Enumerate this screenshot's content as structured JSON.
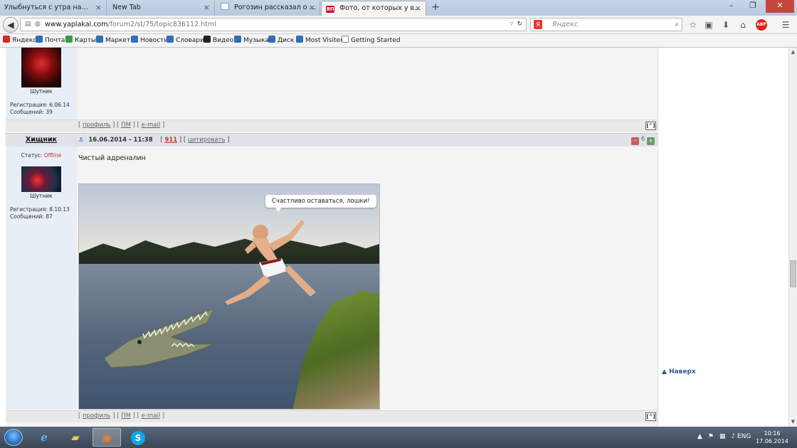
{
  "browser": {
    "tabs": [
      {
        "label": "Улыбнуться с утра на тему сп..."
      },
      {
        "label": "New Tab"
      },
      {
        "label": "Рогозин рассказал о план..."
      },
      {
        "label": "Фото, от которых у вас по..."
      }
    ],
    "url_host": "www.yaplakal.com",
    "url_path": "/forum2/st/75/topic836112.html",
    "search_placeholder": "Яндекс",
    "search_engine_badge": "Я"
  },
  "bookmarks": [
    {
      "label": "Яндекс",
      "color": "#d42a2a"
    },
    {
      "label": "Почта",
      "color": "#2f6fb5"
    },
    {
      "label": "Карты",
      "color": "#3b9a45"
    },
    {
      "label": "Маркет",
      "color": "#2f6fb5"
    },
    {
      "label": "Новости",
      "color": "#2f6fb5"
    },
    {
      "label": "Словари",
      "color": "#2f6fb5"
    },
    {
      "label": "Видео",
      "color": "#222222"
    },
    {
      "label": "Музыка",
      "color": "#2f6fb5"
    },
    {
      "label": "Диск",
      "color": "#2f6fb5"
    },
    {
      "label": "Most Visited",
      "color": "#2f6fb5"
    },
    {
      "label": "Getting Started",
      "color": "#ffffff"
    }
  ],
  "post1": {
    "role": "Шутник",
    "registration": "Регистрация: 6.06.14",
    "messages": "Сообщений: 39",
    "links": [
      "профиль",
      "ПМ",
      "e-mail"
    ]
  },
  "post2": {
    "author": "Хищник",
    "status_label": "Статус:",
    "status_value": "Offline",
    "role": "Шутник",
    "registration": "Регистрация: 8.10.13",
    "messages": "Сообщений: 87",
    "date": "16.06.2014 - 11:38",
    "rating": "911",
    "quote_label": "цитировать",
    "votes": "6",
    "text": "Чистый адреналин",
    "image_caption": "Счастливо оставаться, лошки!",
    "links": [
      "профиль",
      "ПМ",
      "e-mail"
    ]
  },
  "sidebar": {
    "to_top": "Наверх"
  },
  "taskbar": {
    "lang": "ENG",
    "time": "10:16",
    "date": "17.06.2014"
  }
}
